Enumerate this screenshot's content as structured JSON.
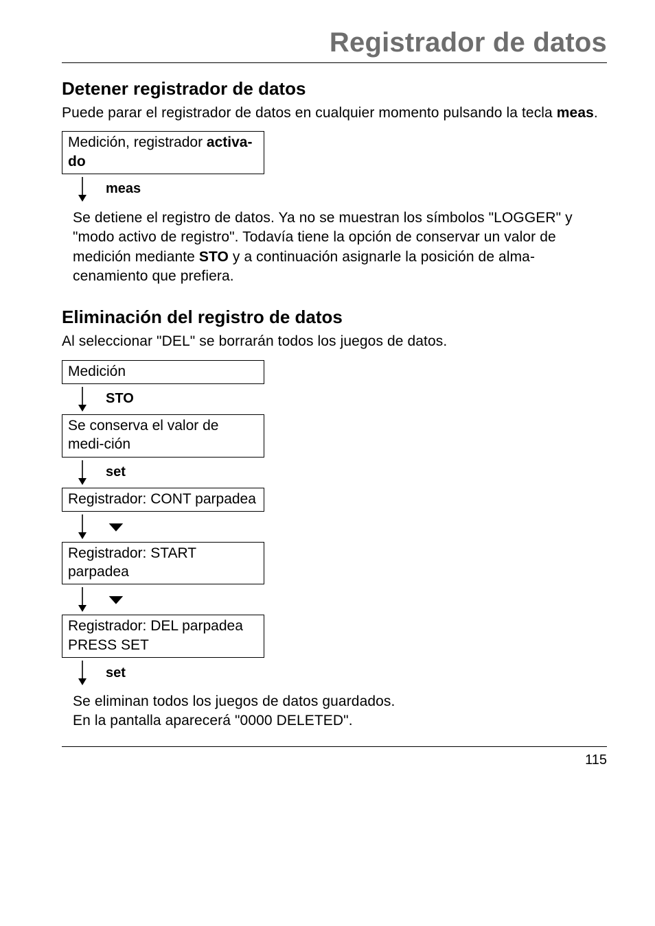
{
  "pageTitle": "Registrador de datos",
  "section1": {
    "heading": "Detener registrador de datos",
    "intro_pre": "Puede parar el registrador de datos en cualquier momento pulsando la tecla ",
    "intro_bold": "meas",
    "intro_post": ".",
    "box1_pre": "Medición, registrador ",
    "box1_bold": "activa-do",
    "arrow_label": "meas",
    "result_pre": "Se detiene el registro de datos. Ya no se muestran los símbolos \"LOGGER\" y \"modo activo de registro\". Todavía tiene la opción de conservar un valor de medición mediante ",
    "result_bold": "STO",
    "result_post": " y a continuación asignarle la posición de alma-cenamiento que prefiera."
  },
  "section2": {
    "heading": "Eliminación del registro de datos",
    "intro": "Al seleccionar \"DEL\" se borrarán todos los juegos de datos.",
    "box_medicion": "Medición",
    "label_sto": "STO",
    "box_conserva": "Se conserva el valor de medi-ción",
    "label_set1": "set",
    "box_cont": "Registrador: CONT parpadea",
    "box_start": "Registrador: START parpadea",
    "box_del": "Registrador: DEL parpadea PRESS SET",
    "label_set2": "set",
    "result_line1": "Se eliminan todos los juegos de datos guardados.",
    "result_line2": "En la pantalla aparecerá \"0000 DELETED\"."
  },
  "pageNumber": "115"
}
